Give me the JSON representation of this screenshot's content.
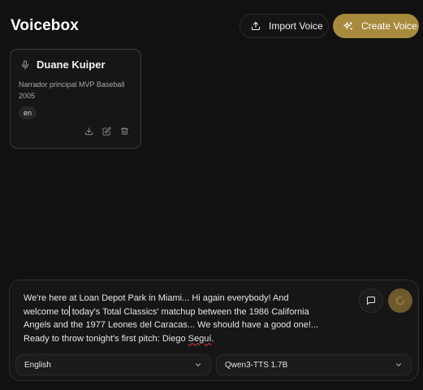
{
  "app": {
    "title": "Voicebox"
  },
  "header": {
    "import_label": "Import Voice",
    "create_label": "Create Voice",
    "icons": {
      "import": "upload-icon",
      "create": "sparkles-icon"
    }
  },
  "voices": [
    {
      "name": "Duane Kuiper",
      "description": "Narrador principal MVP Baseball 2005",
      "language": "en",
      "icons": [
        "mic-icon",
        "download-icon",
        "edit-icon",
        "trash-icon"
      ]
    }
  ],
  "composer": {
    "text_before": "We're here at Loan Depot Park in Miami... Hi again everybody! And welcome to",
    "text_after": " today's Total Classics' matchup between the 1986 California Angels and the 1977 Leones del Caracas... We should have a good one!... Ready to throw tonight's first pitch: Diego ",
    "misspelled_word": "Seguí",
    "text_end": ".",
    "language": "English",
    "model": "Qwen3-TTS 1.7B"
  },
  "colors": {
    "accent": "#a88a3d",
    "background": "#111111",
    "card": "#161616"
  }
}
